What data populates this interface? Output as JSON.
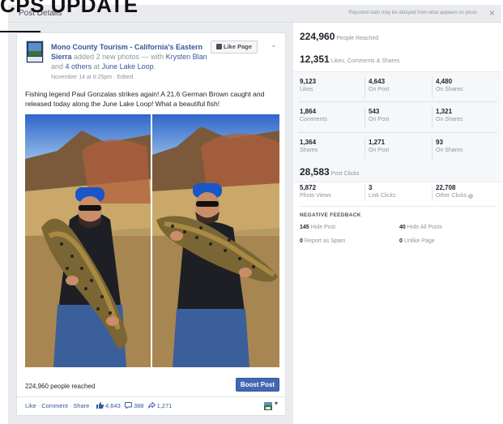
{
  "overlay": {
    "text": "CPS UPDATE"
  },
  "modal": {
    "title": "Post Details",
    "note": "Reported stats may be delayed from what appears on posts",
    "close": "×"
  },
  "post": {
    "page_name": "Mono County Tourism - California's Eastern Sierra",
    "added_text": "added 2 new photos — with",
    "tagged_person": "Krysten Blan",
    "and_text": "and",
    "others": "4 others",
    "at_text": "at",
    "place": "June Lake Loop",
    "place_period": ".",
    "date": "November 14 at 6:25pm · Edited",
    "like_page_label": "Like Page",
    "body": "Fishing legend Paul Gonzalas strikes again! A 21.6 German Brown caught and released today along the June Lake Loop! What a beautiful fish!",
    "reached": "224,960 people reached",
    "boost_label": "Boost Post",
    "actions": {
      "like": "Like",
      "comment": "Comment",
      "share": "Share",
      "likes_count": "4,643",
      "comments_count": "388",
      "shares_count": "1,271"
    }
  },
  "stats": {
    "people_reached": {
      "value": "224,960",
      "label": "People Reached"
    },
    "engagement": {
      "value": "12,351",
      "label": "Likes, Comments & Shares"
    },
    "grid": [
      [
        {
          "value": "9,123",
          "label": "Likes"
        },
        {
          "value": "4,643",
          "label": "On Post"
        },
        {
          "value": "4,480",
          "label": "On Shares"
        }
      ],
      [
        {
          "value": "1,864",
          "label": "Comments"
        },
        {
          "value": "543",
          "label": "On Post"
        },
        {
          "value": "1,321",
          "label": "On Shares"
        }
      ],
      [
        {
          "value": "1,364",
          "label": "Shares"
        },
        {
          "value": "1,271",
          "label": "On Post"
        },
        {
          "value": "93",
          "label": "On Shares"
        }
      ]
    ],
    "post_clicks": {
      "value": "28,583",
      "label": "Post Clicks"
    },
    "clicks": [
      {
        "value": "5,872",
        "label": "Photo Views"
      },
      {
        "value": "3",
        "label": "Link Clicks"
      },
      {
        "value": "22,708",
        "label": "Other Clicks"
      }
    ],
    "negative_feedback": {
      "title": "NEGATIVE FEEDBACK",
      "items": [
        {
          "value": "145",
          "label": "Hide Post"
        },
        {
          "value": "40",
          "label": "Hide All Posts"
        },
        {
          "value": "0",
          "label": "Report as Spam"
        },
        {
          "value": "0",
          "label": "Unlike Page"
        }
      ]
    }
  },
  "colors": {
    "fb_blue": "#4267b2",
    "link": "#365899",
    "muted": "#90949c",
    "panel_bg": "#f6f7f9"
  },
  "icons": [
    "chevron-down-icon",
    "thumb-up-icon",
    "comment-icon",
    "share-icon",
    "info-icon",
    "close-icon"
  ]
}
